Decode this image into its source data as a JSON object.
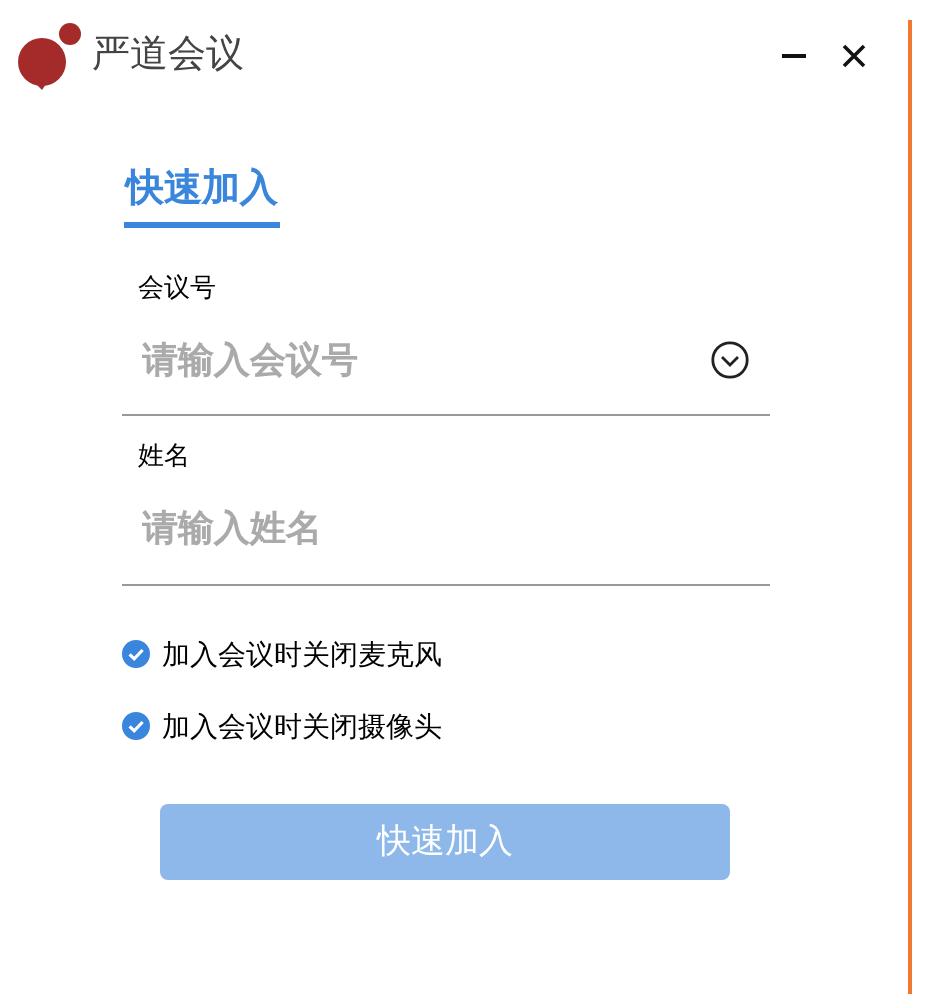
{
  "window": {
    "title": "严道会议"
  },
  "tabs": [
    {
      "label": "快速加入",
      "selected": true
    }
  ],
  "fields": [
    {
      "label": "会议号",
      "placeholder": "请输入会议号",
      "dropdown": true
    },
    {
      "label": "姓名",
      "placeholder": "请输入姓名",
      "dropdown": false
    }
  ],
  "options": [
    {
      "label": "加入会议时关闭麦克风",
      "checked": true
    },
    {
      "label": "加入会议时关闭摄像头",
      "checked": true
    }
  ],
  "join_button": {
    "label": "快速加入",
    "disabled": true
  }
}
